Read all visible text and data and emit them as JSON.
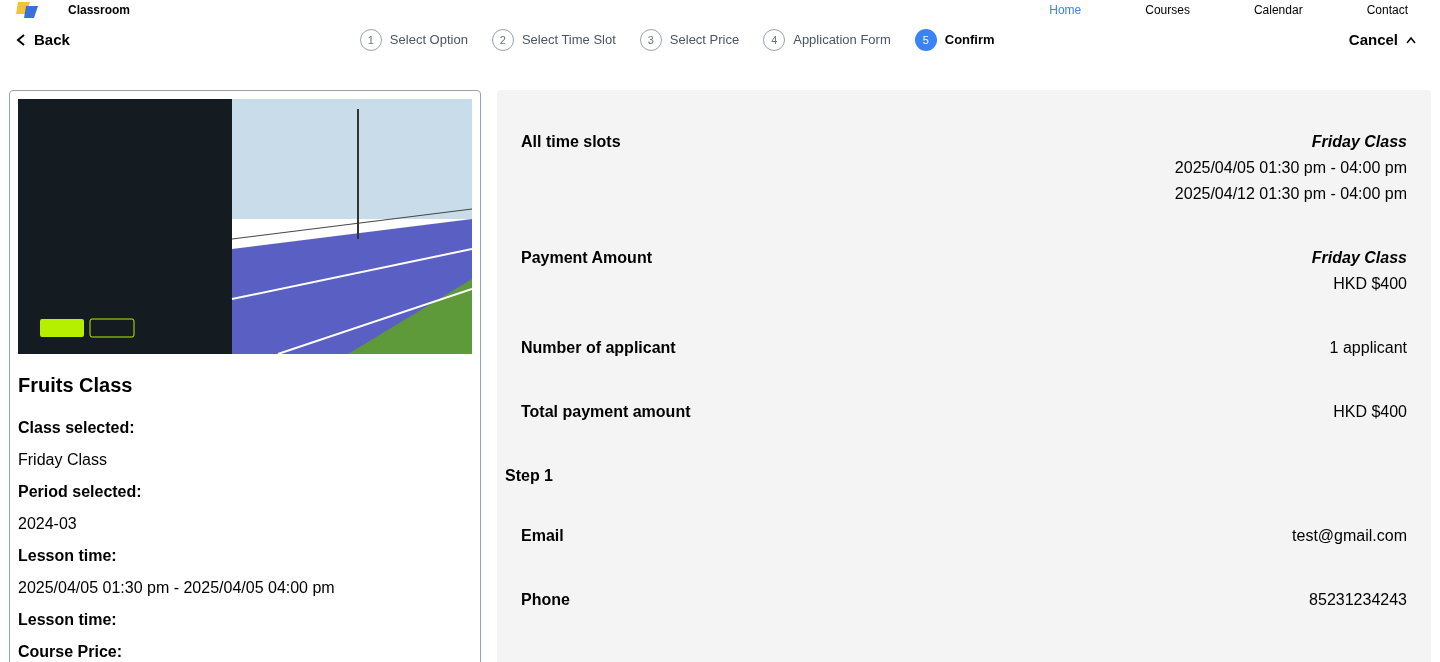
{
  "header": {
    "brand": "Classroom",
    "nav": [
      {
        "label": "Home",
        "selected": true
      },
      {
        "label": "Courses",
        "selected": false
      },
      {
        "label": "Calendar",
        "selected": false
      },
      {
        "label": "Contact"
      }
    ]
  },
  "back": "Back",
  "cancel": "Cancel",
  "steps": [
    {
      "number": "1",
      "label": "Select Option",
      "selected": false
    },
    {
      "number": "2",
      "label": "Select Time Slot",
      "selected": false
    },
    {
      "number": "3",
      "label": "Select Price",
      "selected": false
    },
    {
      "number": "4",
      "label": "Application Form",
      "selected": false
    },
    {
      "number": "5",
      "label": "Confirm",
      "selected": true
    }
  ],
  "course": {
    "title": "Fruits Class",
    "fields": [
      {
        "label": "Class selected:",
        "value": "Friday Class"
      },
      {
        "label": "Period selected:",
        "value": "2024-03"
      },
      {
        "label": "Lesson time:",
        "value": "2025/04/05 01:30 pm - 2025/04/05 04:00 pm"
      },
      {
        "label": "Lesson time:"
      },
      {
        "label": "Course Price:"
      }
    ]
  },
  "summary": [
    {
      "kind": "row",
      "label": "All time slots",
      "lines": [
        "Friday Class",
        "2025/04/05 01:30 pm - 04:00 pm",
        "2025/04/12 01:30 pm - 04:00 pm"
      ]
    },
    {
      "kind": "row",
      "label": "Payment Amount",
      "lines": [
        "Friday Class",
        "HKD $400"
      ]
    },
    {
      "kind": "row",
      "label": "Number of applicant",
      "lines": [
        "1 applicant"
      ]
    },
    {
      "kind": "row",
      "label": "Total payment amount",
      "lines": [
        "HKD $400"
      ]
    },
    {
      "kind": "heading",
      "label": "Step 1"
    },
    {
      "kind": "row",
      "label": "Email",
      "lines": [
        "test@gmail.com"
      ]
    },
    {
      "kind": "row",
      "label": "Phone",
      "lines": [
        "85231234243"
      ]
    }
  ]
}
